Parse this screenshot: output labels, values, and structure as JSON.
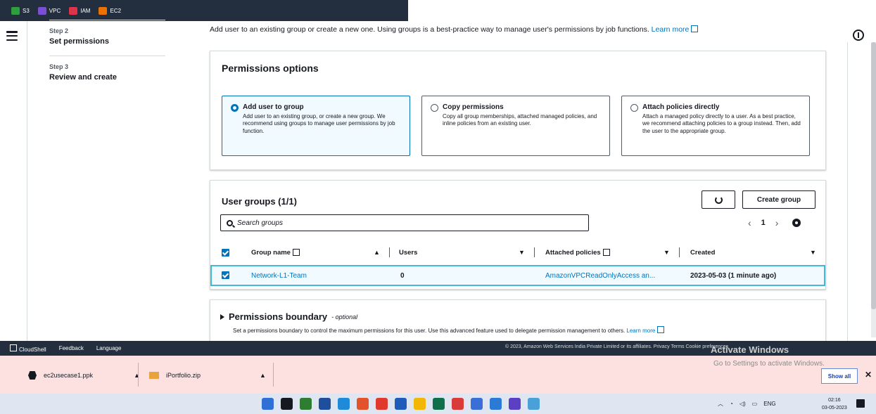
{
  "favorites": [
    {
      "label": "S3",
      "color": "#2e9e3e"
    },
    {
      "label": "VPC",
      "color": "#7b4fd1"
    },
    {
      "label": "IAM",
      "color": "#dd344c"
    },
    {
      "label": "EC2",
      "color": "#ed7100"
    }
  ],
  "steps": [
    {
      "label": "Step 2",
      "title": "Set permissions"
    },
    {
      "label": "Step 3",
      "title": "Review and create"
    }
  ],
  "intro": {
    "text": "Add user to an existing group or create a new one. Using groups is a best-practice way to manage user's permissions by job functions.",
    "link": "Learn more"
  },
  "permissions": {
    "heading": "Permissions options",
    "options": [
      {
        "title": "Add user to group",
        "desc": "Add user to an existing group, or create a new group. We recommend using groups to manage user permissions by job function.",
        "selected": true
      },
      {
        "title": "Copy permissions",
        "desc": "Copy all group memberships, attached managed policies, and inline policies from an existing user.",
        "selected": false
      },
      {
        "title": "Attach policies directly",
        "desc": "Attach a managed policy directly to a user. As a best practice, we recommend attaching policies to a group instead. Then, add the user to the appropriate group.",
        "selected": false
      }
    ]
  },
  "groups": {
    "heading": "User groups (1/1)",
    "create_label": "Create group",
    "search_placeholder": "Search groups",
    "page": "1",
    "columns": [
      "Group name",
      "Users",
      "Attached policies",
      "Created"
    ],
    "rows": [
      {
        "name": "Network-L1-Team",
        "users": "0",
        "policies": "AmazonVPCReadOnlyAccess an...",
        "created": "2023-05-03 (1 minute ago)"
      }
    ]
  },
  "boundary": {
    "title": "Permissions boundary",
    "optional": "- optional",
    "desc": "Set a permissions boundary to control the maximum permissions for this user. Use this advanced feature used to delegate permission management to others.",
    "link": "Learn more"
  },
  "footer": {
    "items": [
      "CloudShell",
      "Feedback",
      "Language"
    ],
    "right": "© 2023, Amazon Web Services India Private Limited or its affiliates.   Privacy   Terms   Cookie preferences"
  },
  "activation": {
    "title": "Activate Windows",
    "sub": "Go to Settings to activate Windows."
  },
  "downloads": {
    "items": [
      "ec2usecase1.ppk",
      "iPortfolio.zip"
    ],
    "show_all": "Show all"
  },
  "taskbar": {
    "icon_colors": [
      "#2f6fd6",
      "#16191f",
      "#2e7d32",
      "#1f4e9c",
      "#1f8ad8",
      "#e2532b",
      "#e03a2f",
      "#1f5bb8",
      "#f2b705",
      "#0f6f4b",
      "#d93b3b",
      "#3a6fd8",
      "#2a7ad6",
      "#5b3fc4",
      "#4aa1d8"
    ],
    "lang": "ENG",
    "time": "02:16",
    "date": "03-05-2023"
  }
}
